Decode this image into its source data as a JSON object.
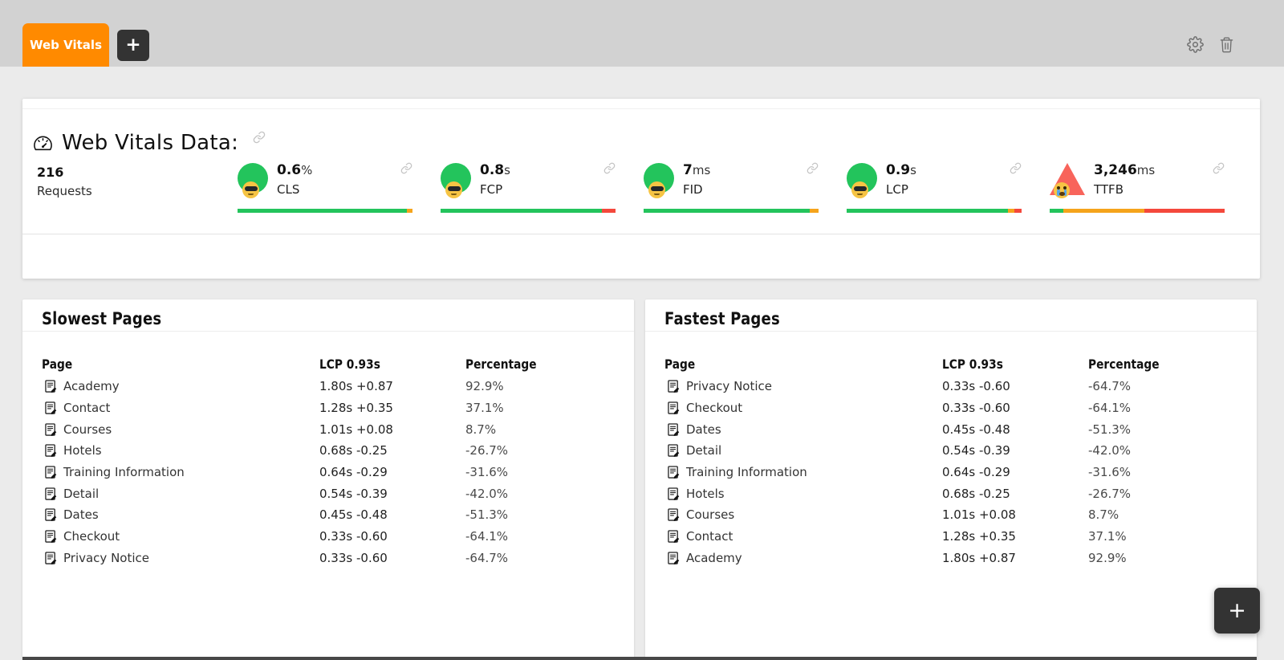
{
  "topbar": {
    "tab_label": "Web Vitals",
    "add_tab_label": "+",
    "icons": [
      "settings-gear",
      "trash"
    ]
  },
  "overview": {
    "icon": "gauge-speedometer",
    "title": "Web Vitals Data:",
    "requests": {
      "value": "216",
      "label": "Requests"
    },
    "metrics": [
      {
        "value": "0.6",
        "unit": "%",
        "label": "CLS",
        "icon": "happy-sunglasses-face",
        "bar": [
          {
            "color": "green",
            "pct": 97
          },
          {
            "color": "orange",
            "pct": 3
          }
        ]
      },
      {
        "value": "0.8",
        "unit": "s",
        "label": "FCP",
        "icon": "happy-sunglasses-face",
        "bar": [
          {
            "color": "green",
            "pct": 92
          },
          {
            "color": "red",
            "pct": 8
          }
        ]
      },
      {
        "value": "7",
        "unit": "ms",
        "label": "FID",
        "icon": "happy-sunglasses-face",
        "bar": [
          {
            "color": "green",
            "pct": 95
          },
          {
            "color": "orange",
            "pct": 5
          }
        ]
      },
      {
        "value": "0.9",
        "unit": "s",
        "label": "LCP",
        "icon": "happy-sunglasses-face",
        "bar": [
          {
            "color": "green",
            "pct": 92
          },
          {
            "color": "orange",
            "pct": 4
          },
          {
            "color": "red",
            "pct": 4
          }
        ]
      },
      {
        "value": "3,246",
        "unit": "ms",
        "label": "TTFB",
        "icon": "crying-warning-triangle",
        "bar": [
          {
            "color": "green",
            "pct": 8
          },
          {
            "color": "orange",
            "pct": 46
          },
          {
            "color": "red",
            "pct": 46
          }
        ]
      }
    ]
  },
  "panels": [
    {
      "title": "Slowest Pages",
      "columns": [
        "Page",
        "LCP 0.93s",
        "Percentage"
      ],
      "rows": [
        [
          "Academy",
          "1.80s +0.87",
          "92.9%"
        ],
        [
          "Contact",
          "1.28s +0.35",
          "37.1%"
        ],
        [
          "Courses",
          "1.01s +0.08",
          "8.7%"
        ],
        [
          "Hotels",
          "0.68s -0.25",
          "-26.7%"
        ],
        [
          "Training Information",
          "0.64s -0.29",
          "-31.6%"
        ],
        [
          "Detail",
          "0.54s -0.39",
          "-42.0%"
        ],
        [
          "Dates",
          "0.45s -0.48",
          "-51.3%"
        ],
        [
          "Checkout",
          "0.33s -0.60",
          "-64.1%"
        ],
        [
          "Privacy Notice",
          "0.33s -0.60",
          "-64.7%"
        ]
      ]
    },
    {
      "title": "Fastest Pages",
      "columns": [
        "Page",
        "LCP 0.93s",
        "Percentage"
      ],
      "rows": [
        [
          "Privacy Notice",
          "0.33s -0.60",
          "-64.7%"
        ],
        [
          "Checkout",
          "0.33s -0.60",
          "-64.1%"
        ],
        [
          "Dates",
          "0.45s -0.48",
          "-51.3%"
        ],
        [
          "Detail",
          "0.54s -0.39",
          "-42.0%"
        ],
        [
          "Training Information",
          "0.64s -0.29",
          "-31.6%"
        ],
        [
          "Hotels",
          "0.68s -0.25",
          "-26.7%"
        ],
        [
          "Courses",
          "1.01s +0.08",
          "8.7%"
        ],
        [
          "Contact",
          "1.28s +0.35",
          "37.1%"
        ],
        [
          "Academy",
          "1.80s +0.87",
          "92.9%"
        ]
      ]
    }
  ],
  "fab_label": "+",
  "colors": {
    "accent_orange": "#ff8a00",
    "good_green": "#23c45c",
    "warn_orange": "#f5a41c",
    "bad_red": "#f4483c",
    "triangle_red": "#f8645b",
    "topbar_gray": "#d2d2d2",
    "page_bg": "#ebebeb"
  }
}
